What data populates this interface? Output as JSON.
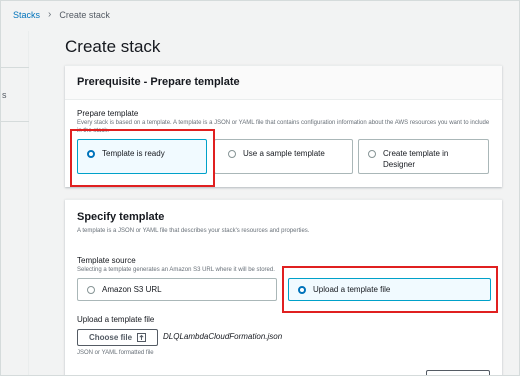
{
  "breadcrumb": {
    "root": "Stacks",
    "current": "Create stack"
  },
  "page": {
    "title": "Create stack"
  },
  "prerequisite": {
    "title": "Prerequisite - Prepare template",
    "field_label": "Prepare template",
    "description": "Every stack is based on a template. A template is a JSON or YAML file that contains configuration information about the AWS resources you want to include in the stack.",
    "options": [
      {
        "label": "Template is ready",
        "selected": true
      },
      {
        "label": "Use a sample template",
        "selected": false
      },
      {
        "label": "Create template in Designer",
        "selected": false
      }
    ]
  },
  "specify": {
    "title": "Specify template",
    "description": "A template is a JSON or YAML file that describes your stack's resources and properties.",
    "source_label": "Template source",
    "source_description": "Selecting a template generates an Amazon S3 URL where it will be stored.",
    "options": [
      {
        "label": "Amazon S3 URL",
        "selected": false
      },
      {
        "label": "Upload a template file",
        "selected": true
      }
    ],
    "upload_label": "Upload a template file",
    "choose_button": "Choose file",
    "file_name": "DLQLambdaCloudFormation.json",
    "upload_hint": "JSON or YAML formatted file"
  },
  "colors": {
    "link": "#0073bb",
    "selected_border": "#00a1c9",
    "highlight": "#e02020"
  },
  "icons": {
    "choose_file": "upload-icon",
    "breadcrumb_separator": "chevron-right-icon"
  }
}
